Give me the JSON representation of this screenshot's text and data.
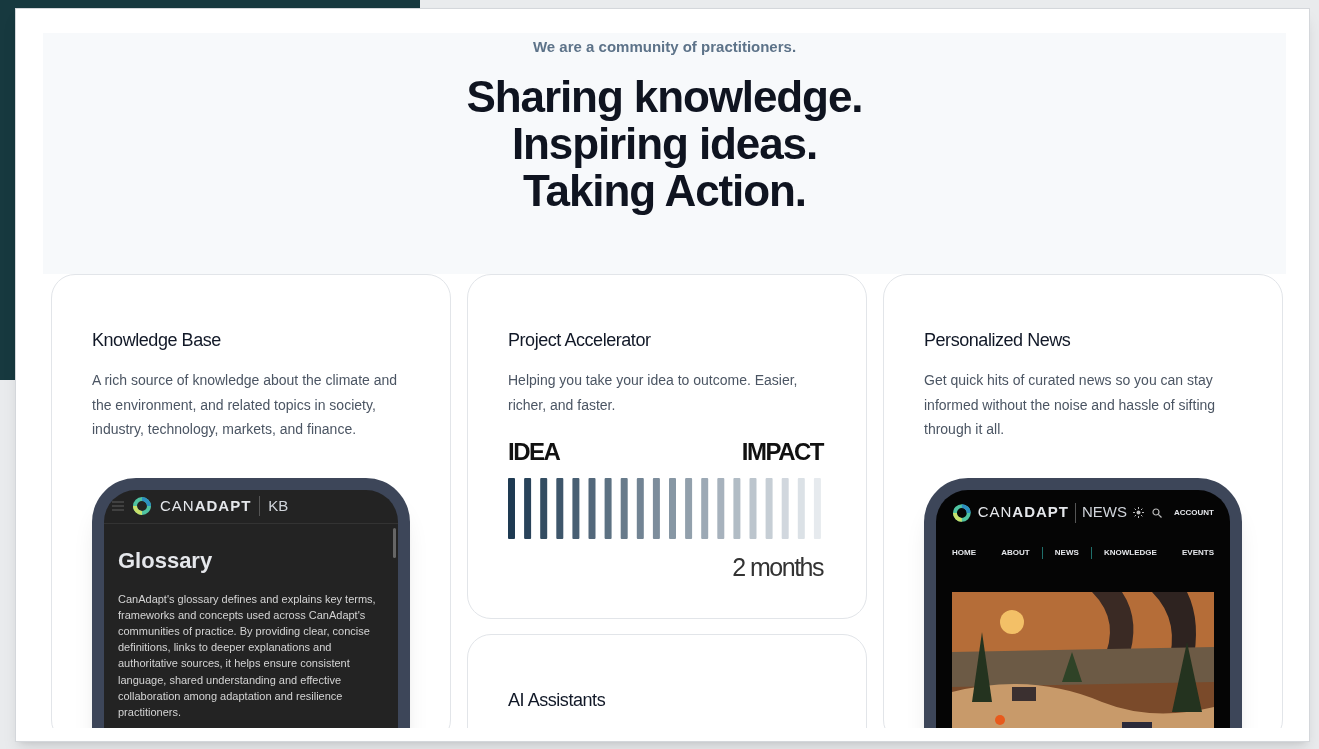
{
  "hero": {
    "eyebrow": "We are a community of practitioners.",
    "headline": [
      "Sharing knowledge.",
      "Inspiring ideas.",
      "Taking Action."
    ]
  },
  "cards": [
    {
      "kind": "phone_kb",
      "title": "Knowledge Base",
      "description": "A rich source of knowledge about the climate and the environment, and related topics in society, industry, technology, markets, and finance.",
      "phone": {
        "brand": "CAN**ADAPT**",
        "section": "KB",
        "heading": "Glossary",
        "body": "CanAdapt's glossary defines and explains key terms, frameworks and concepts used across CanAdapt's communities of practice. By providing clear, concise definitions, links to deeper explanations and authoritative sources, it helps ensure consistent language, shared understanding and effective collaboration among adaptation and resilience practitioners."
      }
    },
    {
      "kind": "timeline",
      "title": "Project Accelerator",
      "description": "Helping you take your idea to outcome. Easier, richer, and faster.",
      "start_label": "IDEA",
      "end_label": "IMPACT",
      "duration": "2 months"
    },
    {
      "kind": "phone_news",
      "title": "Personalized News",
      "description": "Get quick hits of curated news so you can stay informed without the noise and hassle of sifting through it all.",
      "phone": {
        "brand": "CAN**ADAPT**",
        "section": "NEWS",
        "account": "ACCOUNT",
        "nav": [
          "HOME",
          "ABOUT",
          "NEWS",
          "KNOWLEDGE",
          "EVENTS"
        ]
      }
    },
    {
      "kind": "plain",
      "title": "AI Assistants"
    }
  ]
}
